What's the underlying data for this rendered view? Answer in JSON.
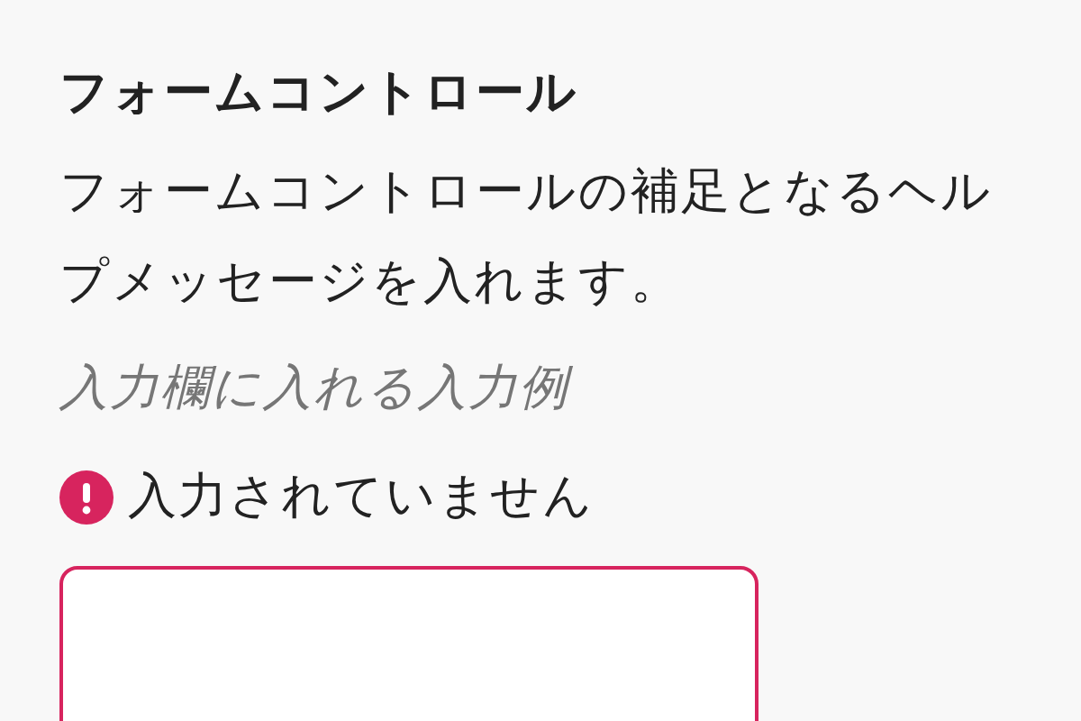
{
  "field": {
    "label": "フォームコントロール",
    "help_text": "フォームコントロールの補足となるヘルプメッセージを入れます。",
    "example": "入力欄に入れる入力例",
    "error": {
      "message": "入力されていません"
    },
    "input": {
      "invalid": true
    }
  }
}
